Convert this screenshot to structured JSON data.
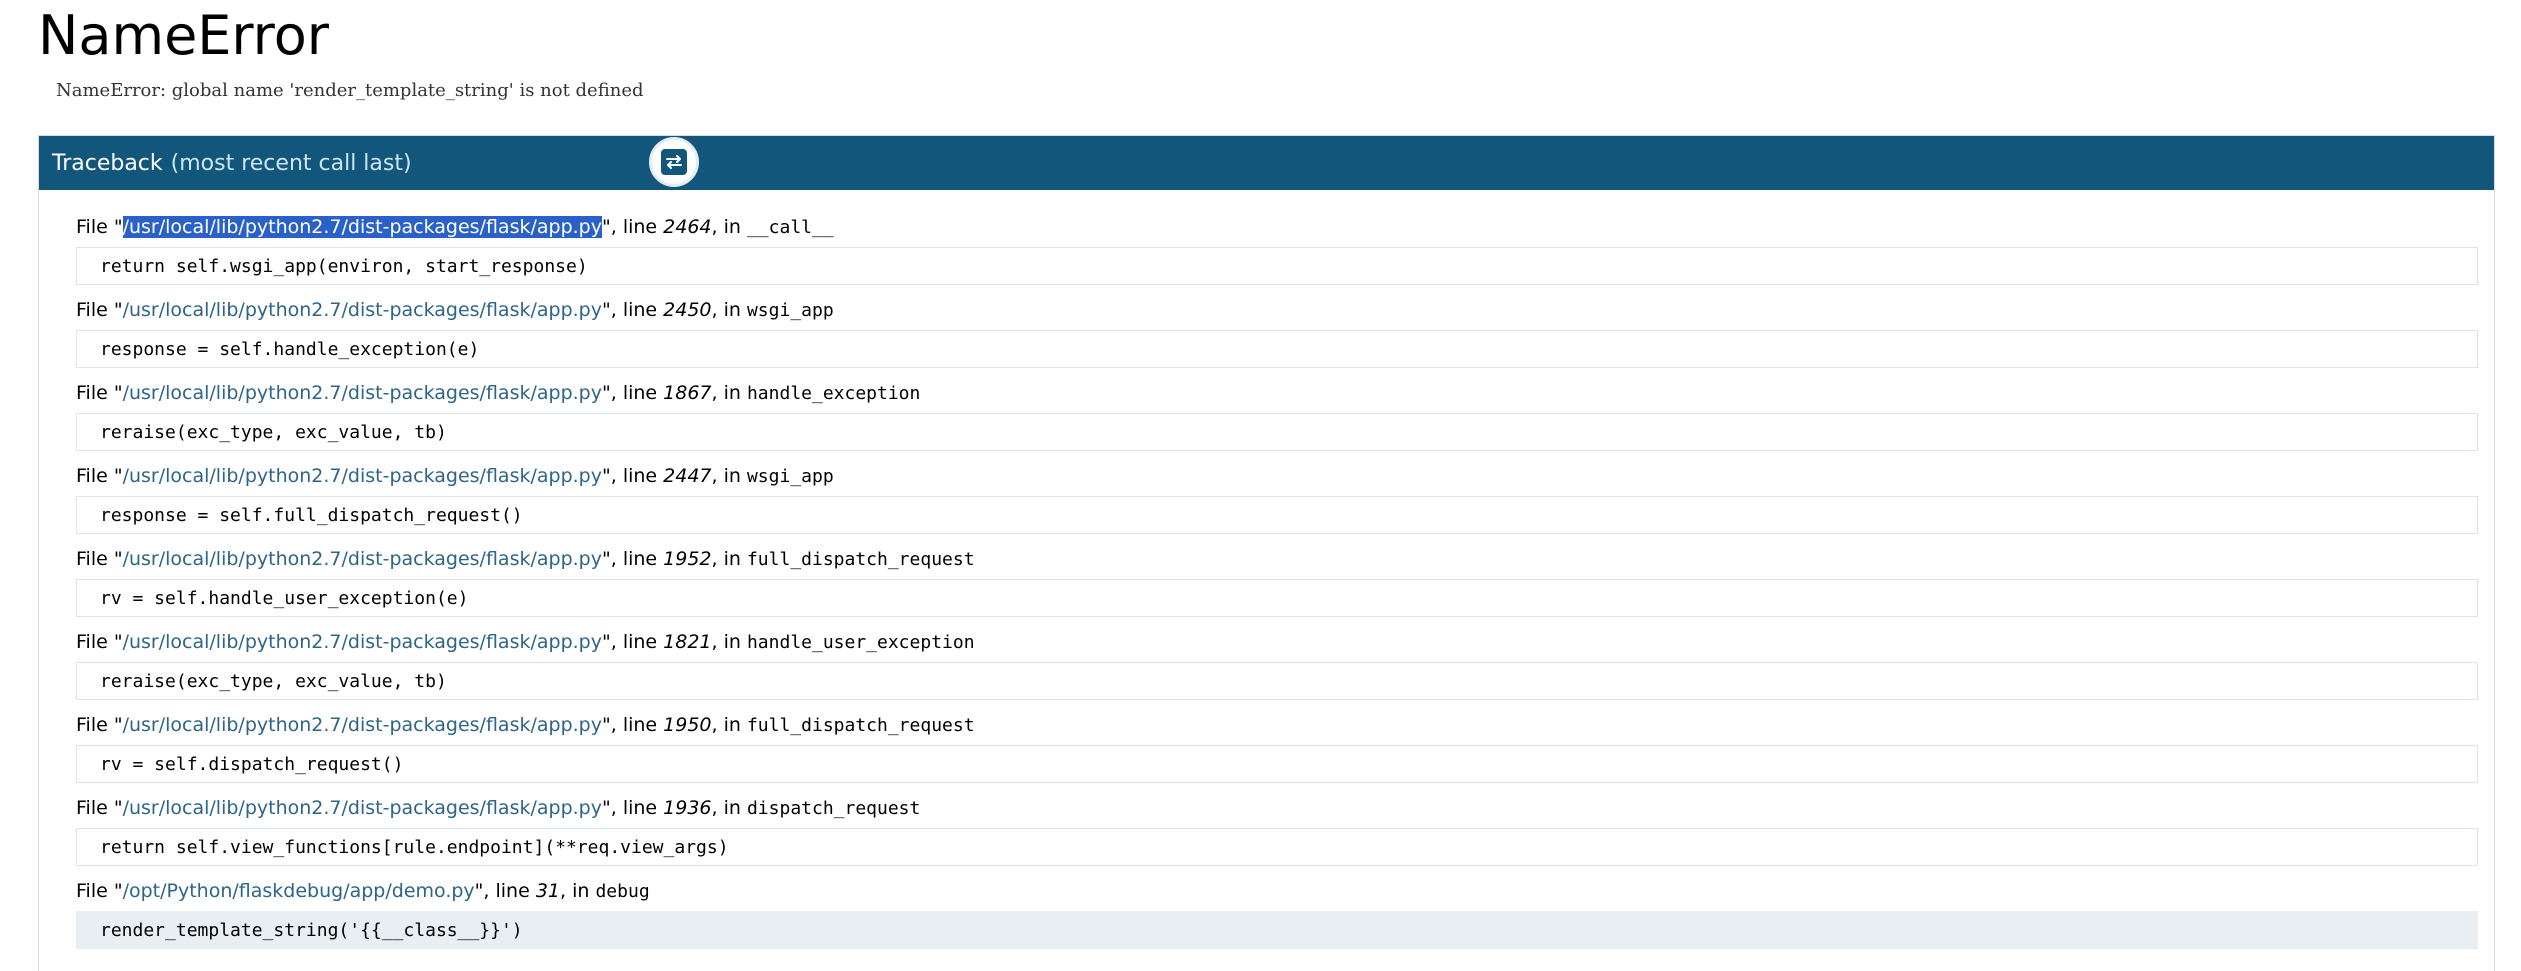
{
  "error": {
    "title": "NameError",
    "message": "NameError: global name 'render_template_string' is not defined"
  },
  "traceback": {
    "header": "Traceback",
    "subheader": "(most recent call last)",
    "toggle_icon": "swap-arrows-icon",
    "frames": [
      {
        "prefix": "File \"",
        "file": "/usr/local/lib/python2.7/dist-packages/flask/app.py",
        "mid": "\", line ",
        "line": "2464",
        "in": ", in ",
        "func": "__call__",
        "code": "return self.wsgi_app(environ, start_response)",
        "selected": true
      },
      {
        "prefix": "File \"",
        "file": "/usr/local/lib/python2.7/dist-packages/flask/app.py",
        "mid": "\", line ",
        "line": "2450",
        "in": ", in ",
        "func": "wsgi_app",
        "code": "response = self.handle_exception(e)"
      },
      {
        "prefix": "File \"",
        "file": "/usr/local/lib/python2.7/dist-packages/flask/app.py",
        "mid": "\", line ",
        "line": "1867",
        "in": ", in ",
        "func": "handle_exception",
        "code": "reraise(exc_type, exc_value, tb)"
      },
      {
        "prefix": "File \"",
        "file": "/usr/local/lib/python2.7/dist-packages/flask/app.py",
        "mid": "\", line ",
        "line": "2447",
        "in": ", in ",
        "func": "wsgi_app",
        "code": "response = self.full_dispatch_request()"
      },
      {
        "prefix": "File \"",
        "file": "/usr/local/lib/python2.7/dist-packages/flask/app.py",
        "mid": "\", line ",
        "line": "1952",
        "in": ", in ",
        "func": "full_dispatch_request",
        "code": "rv = self.handle_user_exception(e)"
      },
      {
        "prefix": "File \"",
        "file": "/usr/local/lib/python2.7/dist-packages/flask/app.py",
        "mid": "\", line ",
        "line": "1821",
        "in": ", in ",
        "func": "handle_user_exception",
        "code": "reraise(exc_type, exc_value, tb)"
      },
      {
        "prefix": "File \"",
        "file": "/usr/local/lib/python2.7/dist-packages/flask/app.py",
        "mid": "\", line ",
        "line": "1950",
        "in": ", in ",
        "func": "full_dispatch_request",
        "code": "rv = self.dispatch_request()"
      },
      {
        "prefix": "File \"",
        "file": "/usr/local/lib/python2.7/dist-packages/flask/app.py",
        "mid": "\", line ",
        "line": "1936",
        "in": ", in ",
        "func": "dispatch_request",
        "code": "return self.view_functions[rule.endpoint](**req.view_args)"
      },
      {
        "prefix": "File \"",
        "file": "/opt/Python/flaskdebug/app/demo.py",
        "mid": "\", line ",
        "line": "31",
        "in": ", in ",
        "func": "debug",
        "code": "render_template_string('{{__class__}}')",
        "current": true
      }
    ]
  },
  "colors": {
    "header_bg": "#13567c",
    "file_link": "#2e6586",
    "selection": "#2a61c8",
    "current_line_bg": "#e8eef2"
  }
}
